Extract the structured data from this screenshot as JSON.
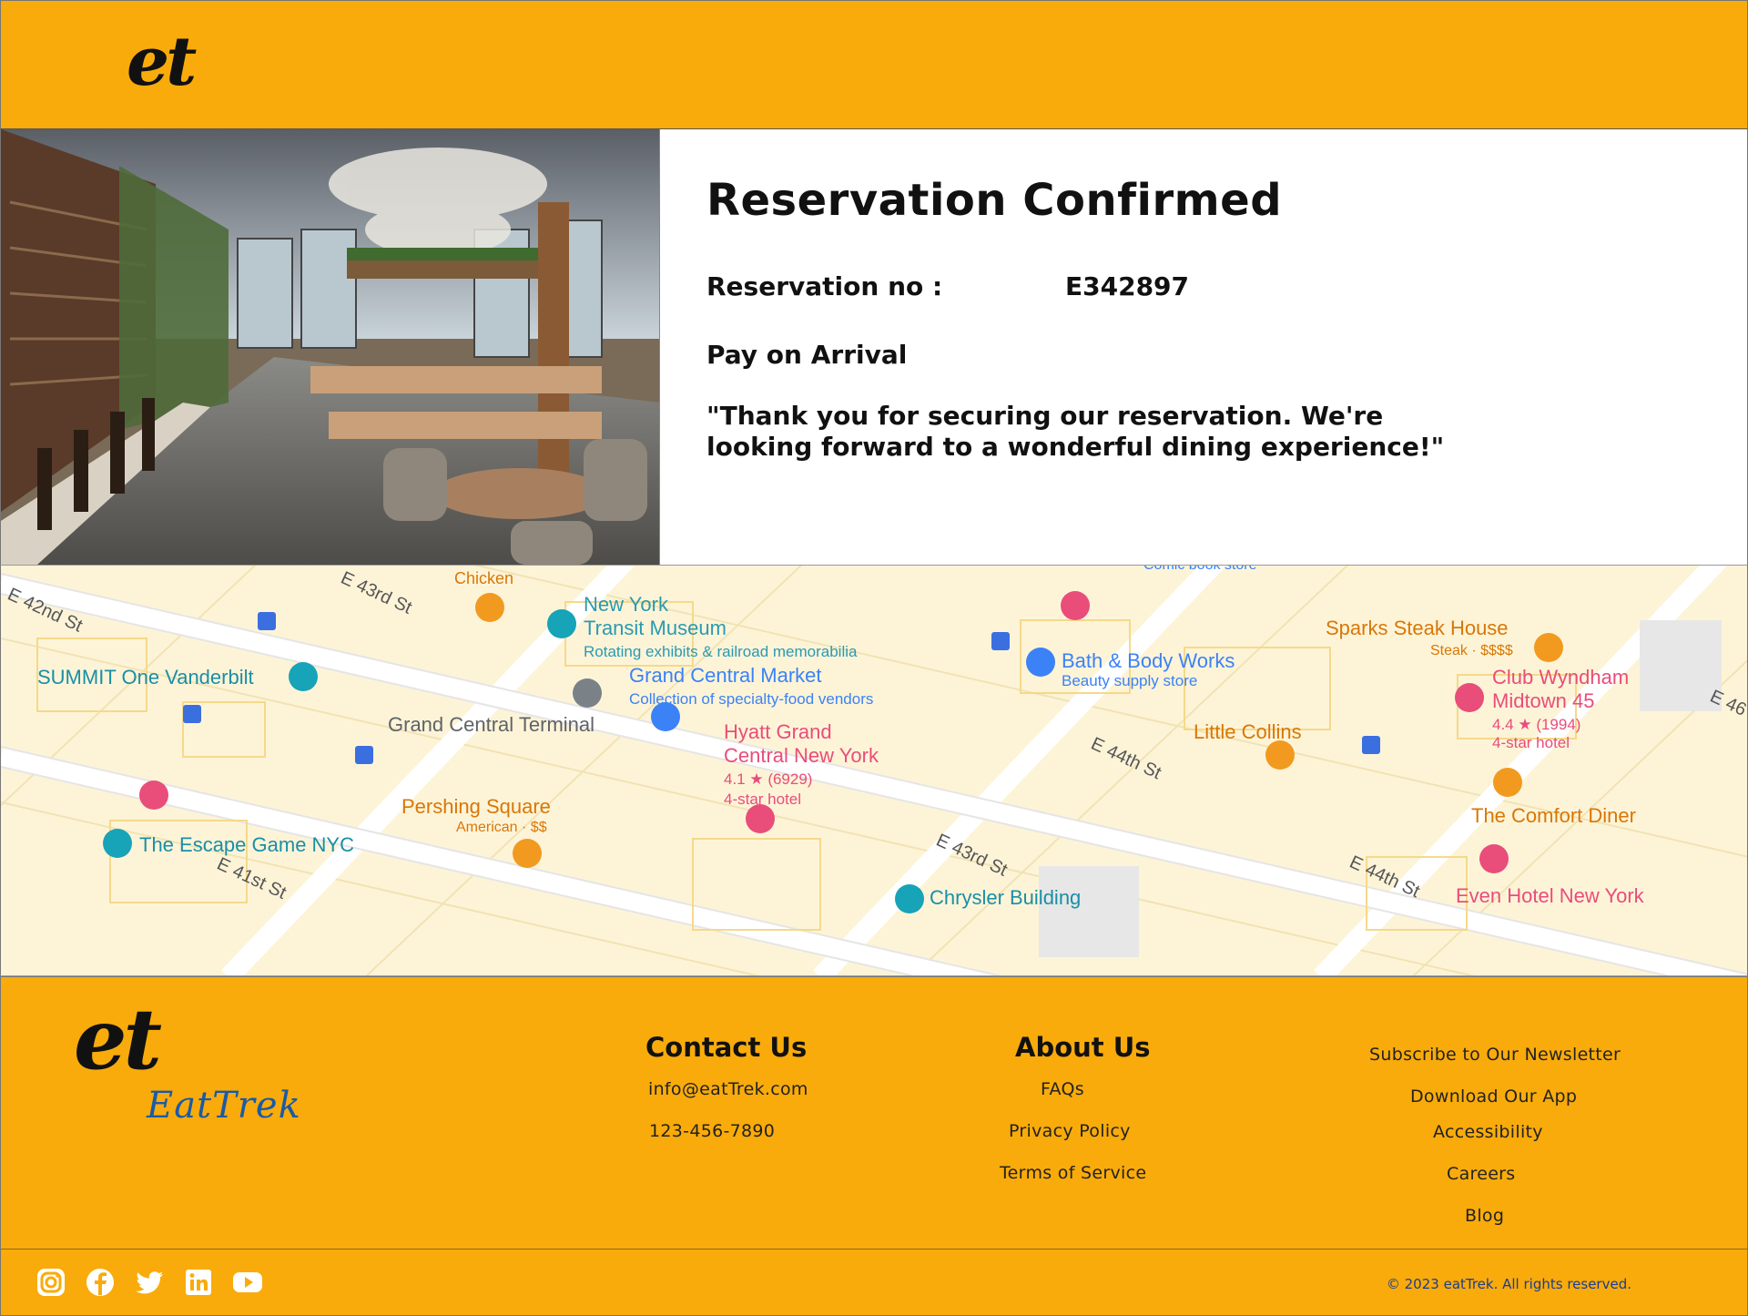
{
  "header": {
    "logo": "et"
  },
  "reservation": {
    "title": "Reservation Confirmed",
    "number_label": "Reservation no :",
    "number_value": "E342897",
    "payment": "Pay on Arrival",
    "message": "\"Thank you for securing our reservation. We're looking forward to a wonderful dining experience!\""
  },
  "map": {
    "streets": [
      "E 43rd St",
      "E 42nd St",
      "E 44th St",
      "E 43rd St",
      "E 41st St",
      "E 44th St",
      "E 46"
    ],
    "places": [
      {
        "name": "Chicken",
        "sub": ""
      },
      {
        "name": "New York",
        "sub": ""
      },
      {
        "name": "Transit Museum",
        "sub": "Rotating exhibits & railroad memorabilia"
      },
      {
        "name": "Grand Central Market",
        "sub": "Collection of specialty-food vendors"
      },
      {
        "name": "SUMMIT One Vanderbilt",
        "sub": ""
      },
      {
        "name": "Grand Central Terminal",
        "sub": ""
      },
      {
        "name": "Bath & Body Works",
        "sub": "Beauty supply store"
      },
      {
        "name": "Sparks Steak House",
        "sub": "Steak · $$$$"
      },
      {
        "name": "Club Wyndham",
        "sub": ""
      },
      {
        "name": "Midtown 45",
        "sub": "4.4 ★ (1994)"
      },
      {
        "name": "4-star hotel",
        "sub": ""
      },
      {
        "name": "Hyatt Grand",
        "sub": ""
      },
      {
        "name": "Central New York",
        "sub": "4.1 ★ (6929)"
      },
      {
        "name": "4-star hotel",
        "sub": ""
      },
      {
        "name": "Little Collins",
        "sub": ""
      },
      {
        "name": "Pershing Square",
        "sub": "American · $$"
      },
      {
        "name": "The Escape Game NYC",
        "sub": ""
      },
      {
        "name": "The Comfort Diner",
        "sub": ""
      },
      {
        "name": "Chrysler Building",
        "sub": ""
      },
      {
        "name": "Even Hotel New York",
        "sub": ""
      },
      {
        "name": "Comic book store",
        "sub": ""
      }
    ]
  },
  "footer": {
    "logo": "et",
    "brand": "EatTrek",
    "contact": {
      "title": "Contact Us",
      "email": "info@eatTrek.com",
      "phone": "123-456-7890"
    },
    "about": {
      "title": "About Us",
      "links": [
        "FAQs",
        "Privacy Policy",
        "Terms of Service"
      ]
    },
    "more": [
      "Subscribe to Our Newsletter",
      "Download Our App",
      "Accessibility",
      "Careers",
      "Blog"
    ],
    "socials": [
      "instagram-icon",
      "facebook-icon",
      "twitter-icon",
      "linkedin-icon",
      "youtube-icon"
    ],
    "copyright": "© 2023 eatTrek. All rights reserved."
  },
  "colors": {
    "brand_orange": "#f9ab0b",
    "brand_blue": "#1b5aa6",
    "text": "#111111"
  }
}
